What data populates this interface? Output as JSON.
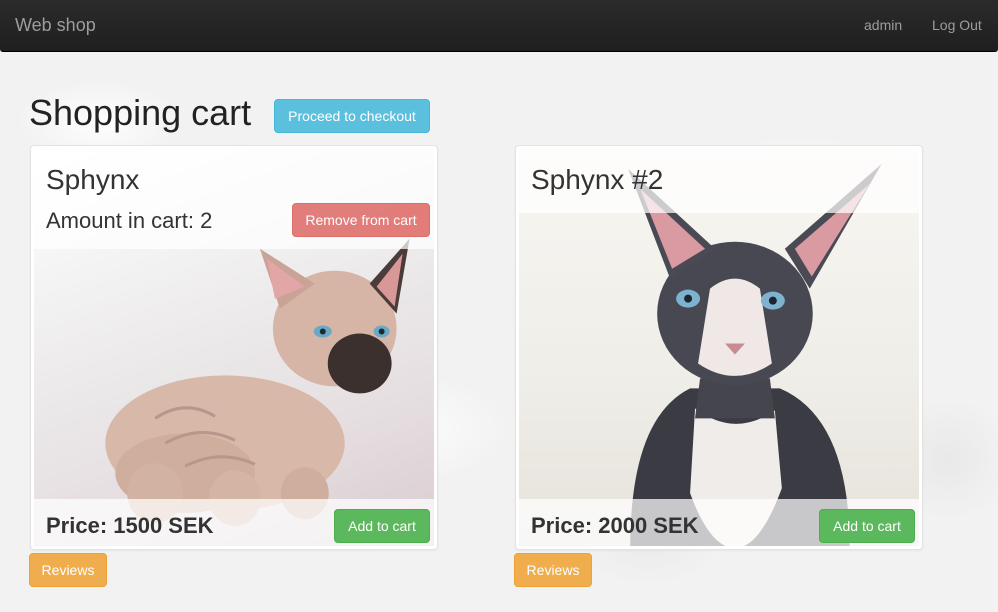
{
  "navbar": {
    "brand": "Web shop",
    "user": "admin",
    "logout": "Log Out"
  },
  "page": {
    "title": "Shopping cart",
    "checkout_label": "Proceed to checkout"
  },
  "products": [
    {
      "name": "Sphynx",
      "amount_label": "Amount in cart: 2",
      "remove_label": "Remove from cart",
      "price_label": "Price: 1500 SEK",
      "add_label": "Add to cart",
      "reviews_label": "Reviews"
    },
    {
      "name": "Sphynx #2",
      "price_label": "Price: 2000 SEK",
      "add_label": "Add to cart",
      "reviews_label": "Reviews"
    }
  ],
  "colors": {
    "navbar": "#222222",
    "info": "#5bc0de",
    "danger": "#d9534f",
    "success": "#5cb85c",
    "warning": "#f0ad4e"
  }
}
